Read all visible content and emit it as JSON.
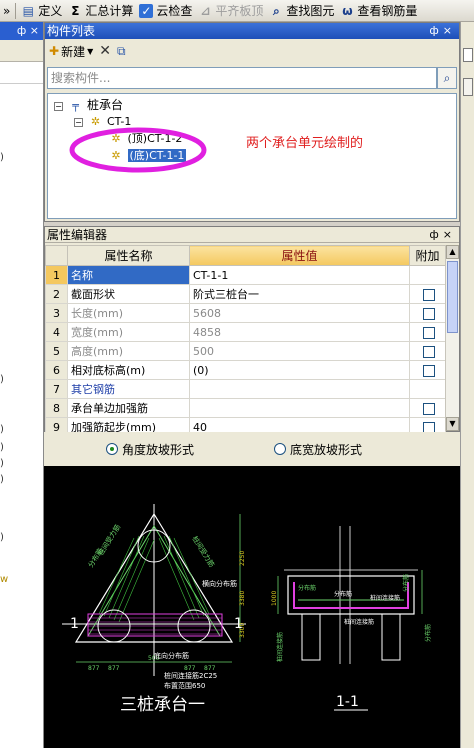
{
  "toolbar": {
    "overflow": "»",
    "items": [
      {
        "label": "定义",
        "icon": "define-icon"
      },
      {
        "label": "汇总计算",
        "icon": "sigma-icon"
      },
      {
        "label": "云检查",
        "icon": "cloud-check-icon"
      },
      {
        "label": "平齐板顶",
        "icon": "align-slab-icon",
        "disabled": true
      },
      {
        "label": "查找图元",
        "icon": "find-icon"
      },
      {
        "label": "查看钢筋量",
        "icon": "rebar-view-icon"
      }
    ]
  },
  "component_panel": {
    "title": "构件列表",
    "new_label": "新建",
    "search_placeholder": "搜索构件...",
    "tree": {
      "root": "桩承台",
      "child": "CT-1",
      "units": [
        "(顶)CT-1-2",
        "(底)CT-1-1"
      ]
    },
    "annotation": "两个承台单元绘制的"
  },
  "property_panel": {
    "title": "属性编辑器",
    "headers": [
      "属性名称",
      "属性值",
      "附加"
    ],
    "rows": [
      {
        "n": "1",
        "name": "名称",
        "value": "CT-1-1",
        "check": false
      },
      {
        "n": "2",
        "name": "截面形状",
        "value": "阶式三桩台一",
        "check": true
      },
      {
        "n": "3",
        "name": "长度(mm)",
        "value": "5608",
        "check": true
      },
      {
        "n": "4",
        "name": "宽度(mm)",
        "value": "4858",
        "check": true
      },
      {
        "n": "5",
        "name": "高度(mm)",
        "value": "500",
        "check": true
      },
      {
        "n": "6",
        "name": "相对底标高(m)",
        "value": "(0)",
        "check": true
      },
      {
        "n": "7",
        "name": "其它钢筋",
        "value": "",
        "check": false
      },
      {
        "n": "8",
        "name": "承台单边加强筋",
        "value": "",
        "check": true
      },
      {
        "n": "9",
        "name": "加强筋起步(mm)",
        "value": "40",
        "check": true
      }
    ]
  },
  "options": {
    "angle_slope": "角度放坡形式",
    "width_slope": "底宽放坡形式",
    "selected": "angle"
  },
  "drawing": {
    "plan_title": "三桩承台一",
    "section_title": "1-1",
    "section_mark": "1",
    "labels": {
      "side1": "桩间受力筋",
      "side2": "桩间受力筋",
      "dist": "分布筋",
      "dist_lr": "横向分布筋",
      "bottom_dist": "底向分布筋",
      "bottom_tie": "桩间连接筋2C25",
      "bottom_range": "布置范围650",
      "sec_dist1": "分布筋",
      "sec_dist2": "分布筋",
      "sec_tie": "桩间连接筋",
      "sec_tie2": "桩间连接筋",
      "sec_dist3": "分布筋",
      "sec_side": "分布筋"
    },
    "dims": {
      "a": "877",
      "b": "877",
      "c": "877",
      "d": "877",
      "e": "500",
      "f": "3380",
      "g": "2250",
      "h": "3300",
      "i": "1000"
    }
  }
}
